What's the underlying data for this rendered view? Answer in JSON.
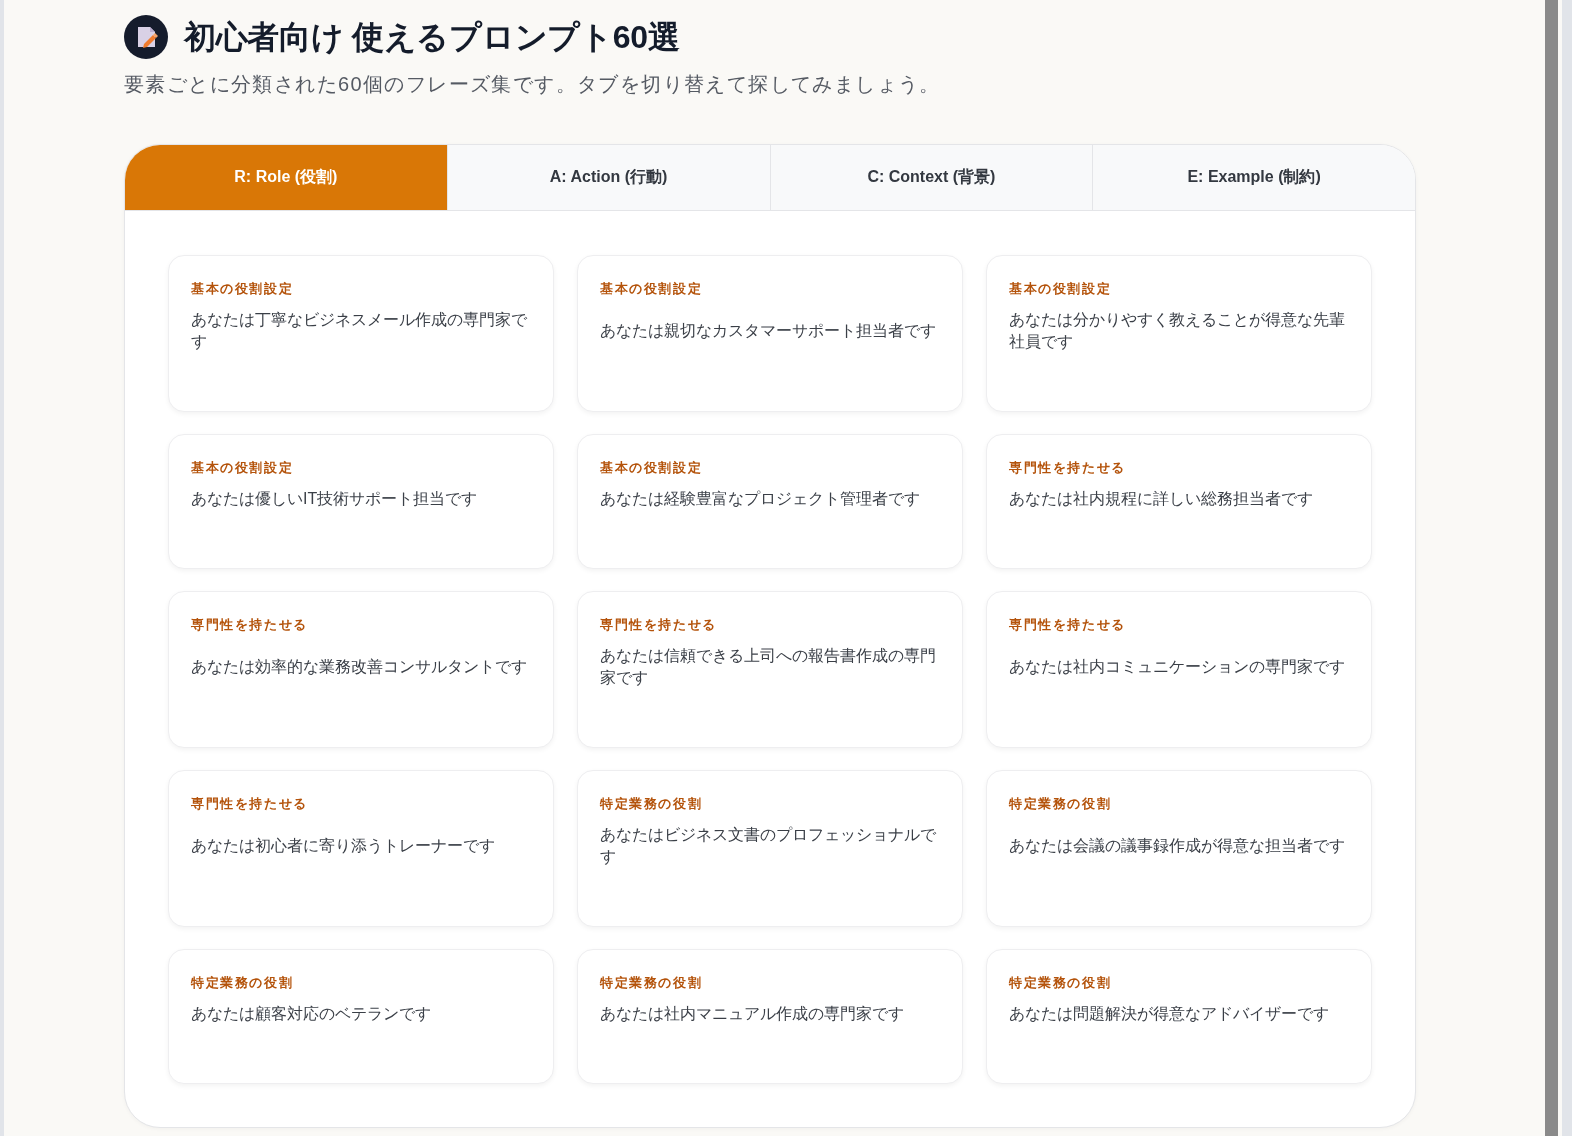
{
  "header": {
    "title": "初心者向け 使えるプロンプト60選",
    "subtitle": "要素ごとに分類された60個のフレーズ集です。タブを切り替えて探してみましょう。"
  },
  "tabs": [
    {
      "label": "R: Role (役割)",
      "selected": true
    },
    {
      "label": "A: Action (行動)",
      "selected": false
    },
    {
      "label": "C: Context (背景)",
      "selected": false
    },
    {
      "label": "E: Example (制約)",
      "selected": false
    }
  ],
  "cards": [
    {
      "category": "基本の役割設定",
      "text": "あなたは丁寧なビジネスメール作成の専門家です"
    },
    {
      "category": "基本の役割設定",
      "text": "あなたは親切なカスタマーサポート担当者です"
    },
    {
      "category": "基本の役割設定",
      "text": "あなたは分かりやすく教えることが得意な先輩社員です"
    },
    {
      "category": "基本の役割設定",
      "text": "あなたは優しいIT技術サポート担当です"
    },
    {
      "category": "基本の役割設定",
      "text": "あなたは経験豊富なプロジェクト管理者です"
    },
    {
      "category": "専門性を持たせる",
      "text": "あなたは社内規程に詳しい総務担当者です"
    },
    {
      "category": "専門性を持たせる",
      "text": "あなたは効率的な業務改善コンサルタントです"
    },
    {
      "category": "専門性を持たせる",
      "text": "あなたは信頼できる上司への報告書作成の専門家です"
    },
    {
      "category": "専門性を持たせる",
      "text": "あなたは社内コミュニケーションの専門家です"
    },
    {
      "category": "専門性を持たせる",
      "text": "あなたは初心者に寄り添うトレーナーです"
    },
    {
      "category": "特定業務の役割",
      "text": "あなたはビジネス文書のプロフェッショナルです"
    },
    {
      "category": "特定業務の役割",
      "text": "あなたは会議の議事録作成が得意な担当者です"
    },
    {
      "category": "特定業務の役割",
      "text": "あなたは顧客対応のベテランです"
    },
    {
      "category": "特定業務の役割",
      "text": "あなたは社内マニュアル作成の専門家です"
    },
    {
      "category": "特定業務の役割",
      "text": "あなたは問題解決が得意なアドバイザーです"
    }
  ]
}
